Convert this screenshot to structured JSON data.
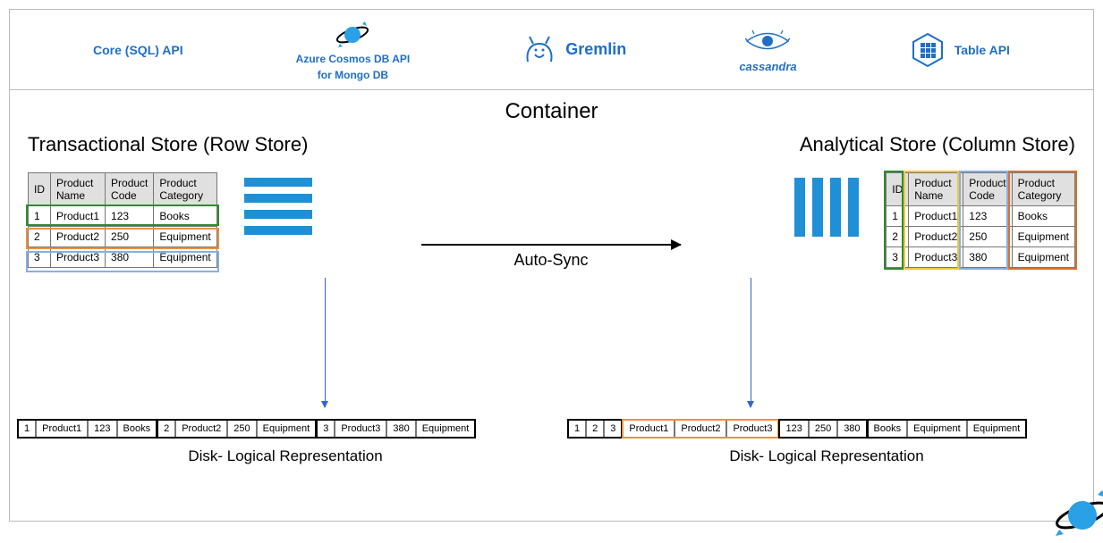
{
  "apis": {
    "core_sql": "Core (SQL) API",
    "cosmos_mongo_line1": "Azure Cosmos DB API",
    "cosmos_mongo_line2": "for Mongo DB",
    "gremlin": "Gremlin",
    "cassandra": "cassandra",
    "table": "Table API"
  },
  "container_title": "Container",
  "left": {
    "title": "Transactional Store (Row Store)",
    "disk_label": "Disk- Logical Representation"
  },
  "right": {
    "title": "Analytical Store (Column Store)",
    "disk_label": "Disk- Logical Representation"
  },
  "sync_label": "Auto-Sync",
  "table": {
    "headers": {
      "id": "ID",
      "name": "Product\nName",
      "code": "Product\nCode",
      "category": "Product\nCategory"
    },
    "rows": [
      {
        "id": "1",
        "name": "Product1",
        "code": "123",
        "category": "Books"
      },
      {
        "id": "2",
        "name": "Product2",
        "code": "250",
        "category": "Equipment"
      },
      {
        "id": "3",
        "name": "Product3",
        "code": "380",
        "category": "Equipment"
      }
    ]
  },
  "colors": {
    "row_hl": [
      "#2e8b2e",
      "#e8923e",
      "#8aaede"
    ],
    "col_hl": [
      "#2e8b2e",
      "#f0c93a",
      "#8aaede",
      "#d9732c"
    ]
  }
}
